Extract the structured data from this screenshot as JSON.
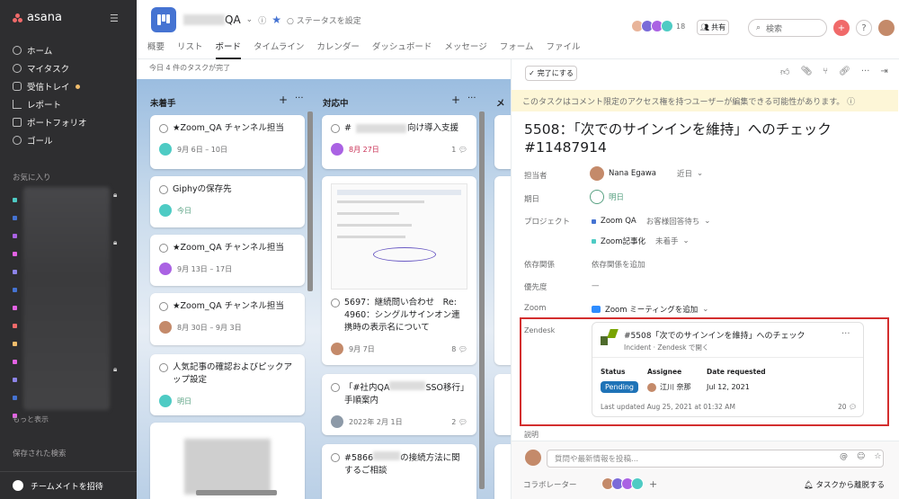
{
  "sidebar": {
    "logo": "asana",
    "nav": [
      {
        "label": "ホーム",
        "icon": "home-icon"
      },
      {
        "label": "マイタスク",
        "icon": "check-circle-icon"
      },
      {
        "label": "受信トレイ",
        "icon": "bell-icon"
      },
      {
        "label": "レポート",
        "icon": "chart-line-icon"
      },
      {
        "label": "ポートフォリオ",
        "icon": "folder-icon"
      },
      {
        "label": "ゴール",
        "icon": "person-icon"
      }
    ],
    "favorites_title": "お気に入り",
    "favorite_colors": [
      "#4ecbc4",
      "#4573d2",
      "#aa62e3",
      "#e362e3",
      "#8d84e8",
      "#4573d2",
      "#e362e3",
      "#f06a6a",
      "#f1bd6c",
      "#e362e3",
      "#8d84e8",
      "#4573d2",
      "#e362e3"
    ],
    "show_more": "もっと表示",
    "saved_searches": "保存された検索",
    "invite": "チームメイトを招待"
  },
  "header": {
    "project_name_suffix": "QA",
    "status": "ステータスを設定",
    "tabs": [
      "概要",
      "リスト",
      "ボード",
      "タイムライン",
      "カレンダー",
      "ダッシュボード",
      "メッセージ",
      "フォーム",
      "ファイル"
    ],
    "active_tab": "ボード",
    "member_count": "18",
    "share": "共有",
    "search_placeholder": "検索"
  },
  "board": {
    "completed_note": "今日 4 件のタスクが完了",
    "columns": [
      {
        "title": "未着手",
        "cards": [
          {
            "title": "★Zoom_QA チャンネル担当",
            "date": "9月 6日 – 10日",
            "date_color": "normal"
          },
          {
            "title": "Giphyの保存先",
            "date": "今日",
            "date_color": "green"
          },
          {
            "title": "★Zoom_QA チャンネル担当",
            "date": "9月 13日 – 17日",
            "date_color": "normal"
          },
          {
            "title": "★Zoom_QA チャンネル担当",
            "date": "8月 30日 – 9月 3日",
            "date_color": "normal"
          },
          {
            "title": "人気記事の確認およびピックアップ設定",
            "date": "明日",
            "date_color": "green"
          }
        ]
      },
      {
        "title": "対応中",
        "cards": [
          {
            "title_prefix": "#",
            "title_suffix": "向け導入支援",
            "date": "8月 27日",
            "date_color": "red",
            "comments": "1"
          },
          {
            "title": "5697：継続問い合わせ　Re: 4960：シングルサインオン連携時の表示名について",
            "date": "9月 7日",
            "date_color": "normal",
            "comments": "8"
          },
          {
            "title_prefix": "「#社内QA",
            "title_suffix": "SSO移行」手順案内",
            "date": "2022年 2月 1日",
            "date_color": "normal",
            "comments": "2"
          },
          {
            "title_prefix": "#5866",
            "title_suffix": "の接続方法に関するご相談",
            "date": "",
            "date_color": "normal"
          }
        ]
      }
    ]
  },
  "detail": {
    "complete_button": "完了にする",
    "banner": "このタスクはコメント限定のアクセス権を持つユーザーが編集できる可能性があります。",
    "title": "5508：「次でのサインインを維持」へのチェック #11487914",
    "fields": {
      "assignee_label": "担当者",
      "assignee": "Nana Egawa",
      "assignee_extra": "近日",
      "due_label": "期日",
      "due": "明日",
      "project_label": "プロジェクト",
      "project1": "Zoom QA",
      "project1_section": "お客様回答待ち",
      "project2": "Zoom記事化",
      "project2_section": "未着手",
      "dependency_label": "依存関係",
      "dependency": "依存関係を追加",
      "priority_label": "優先度",
      "priority": "—",
      "zoom_label": "Zoom",
      "zoom": "Zoom ミーティングを追加",
      "zendesk_label": "Zendesk"
    },
    "zendesk": {
      "title": "#5508「次でのサインインを維持」へのチェック",
      "subtitle": "Incident · Zendesk で開く",
      "status_label": "Status",
      "status": "Pending",
      "assignee_label": "Assignee",
      "assignee": "江川 奈那",
      "date_label": "Date requested",
      "date": "Jul 12, 2021",
      "updated": "Last updated Aug 25, 2021 at 01:32 AM",
      "comments": "20"
    },
    "description_label": "説明",
    "comment_placeholder": "質問や最新情報を投稿...",
    "collaborators_label": "コラボレーター",
    "leave_task": "タスクから離脱する"
  }
}
